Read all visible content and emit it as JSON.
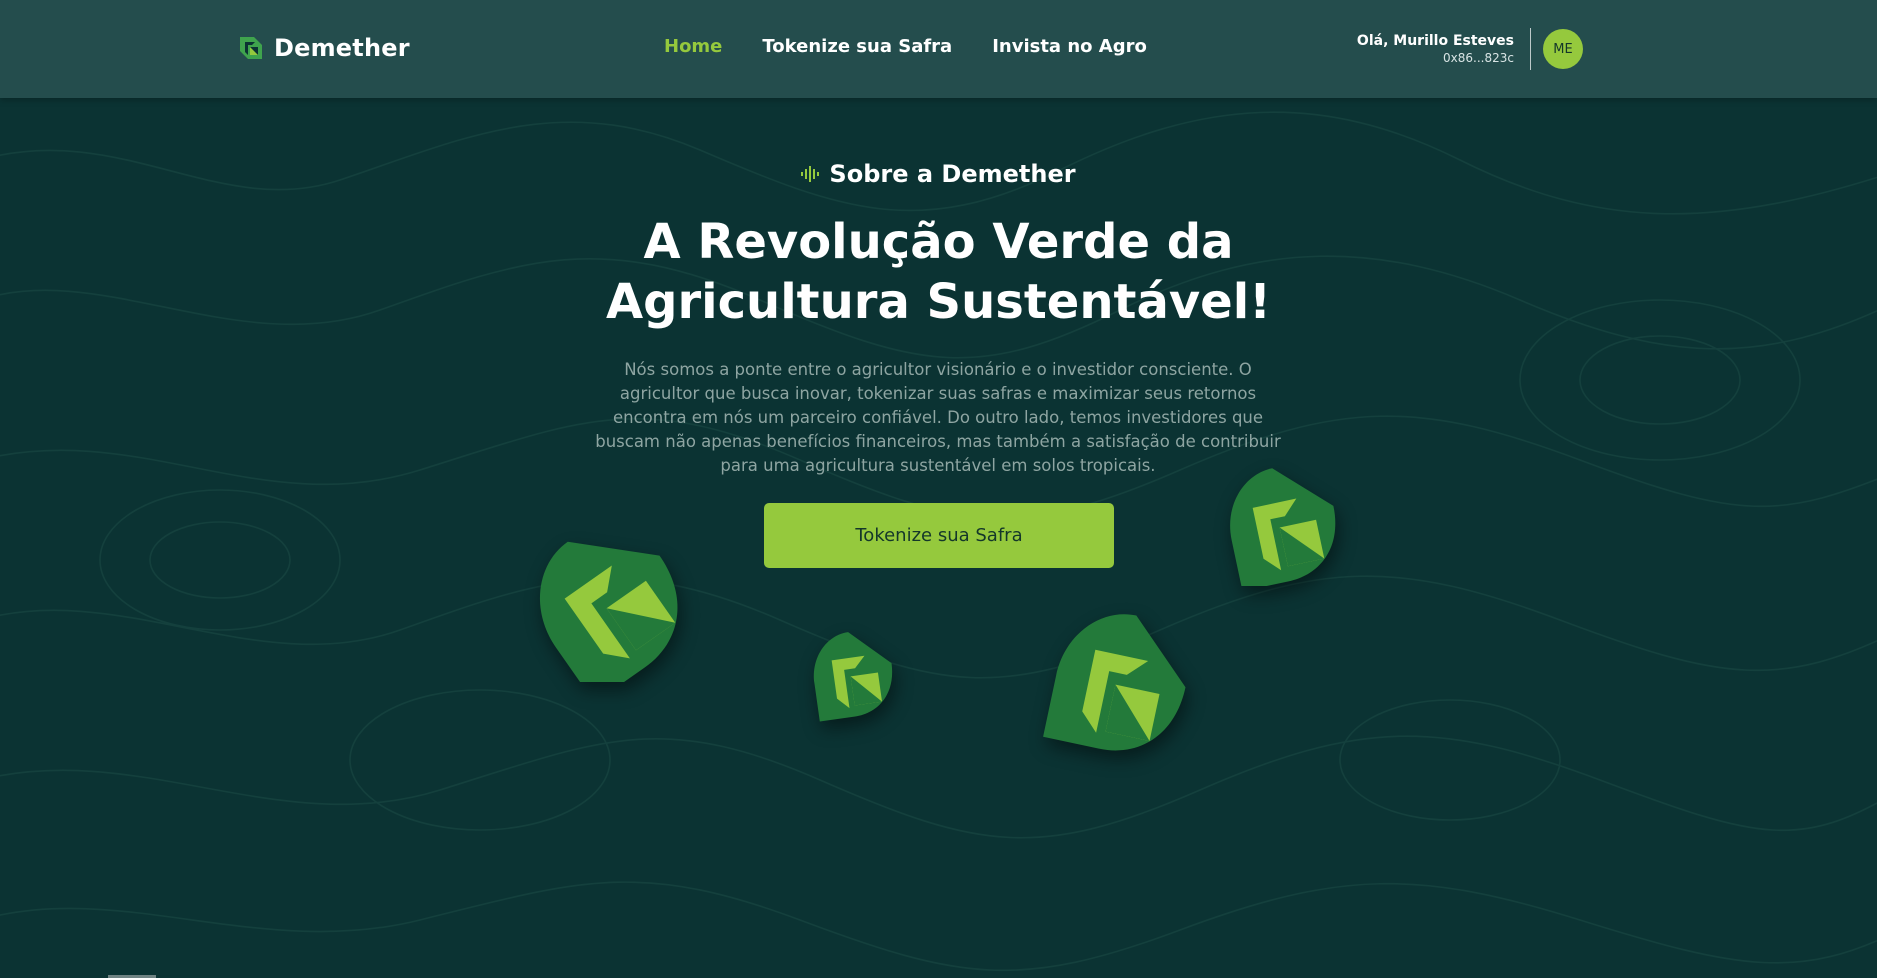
{
  "brand": {
    "name": "Demether",
    "icon": "demether-leaf-logo-icon"
  },
  "nav": {
    "items": [
      {
        "label": "Home",
        "active": true
      },
      {
        "label": "Tokenize sua Safra",
        "active": false
      },
      {
        "label": "Invista no Agro",
        "active": false
      }
    ]
  },
  "user": {
    "greeting": "Olá, Murillo Esteves",
    "wallet": "0x86...823c",
    "initials": "ME"
  },
  "hero": {
    "eyebrow_icon": "sound-wave-icon",
    "eyebrow": "Sobre a Demether",
    "headline_line1": "A Revolução Verde da",
    "headline_line2": "Agricultura Sustentável!",
    "description": "Nós somos a ponte entre o agricultor visionário e o investidor consciente. O agricultor que busca inovar, tokenizar suas safras e maximizar seus retornos encontra em nós um parceiro confiável. Do outro lado, temos investidores que buscam não apenas benefícios financeiros, mas também a satisfação de contribuir para uma agricultura sustentável em solos tropicais.",
    "cta_label": "Tokenize sua Safra",
    "decorations": [
      "leaf-logo-icon",
      "leaf-logo-icon",
      "leaf-logo-icon",
      "leaf-logo-icon",
      "leaf-logo-icon"
    ]
  },
  "colors": {
    "background": "#0b3333",
    "navbar": "#244d4d",
    "accent": "#95c93d",
    "leaf_dark": "#237a3a",
    "leaf_light": "#95c93d",
    "muted_text": "#8ea5a2"
  }
}
